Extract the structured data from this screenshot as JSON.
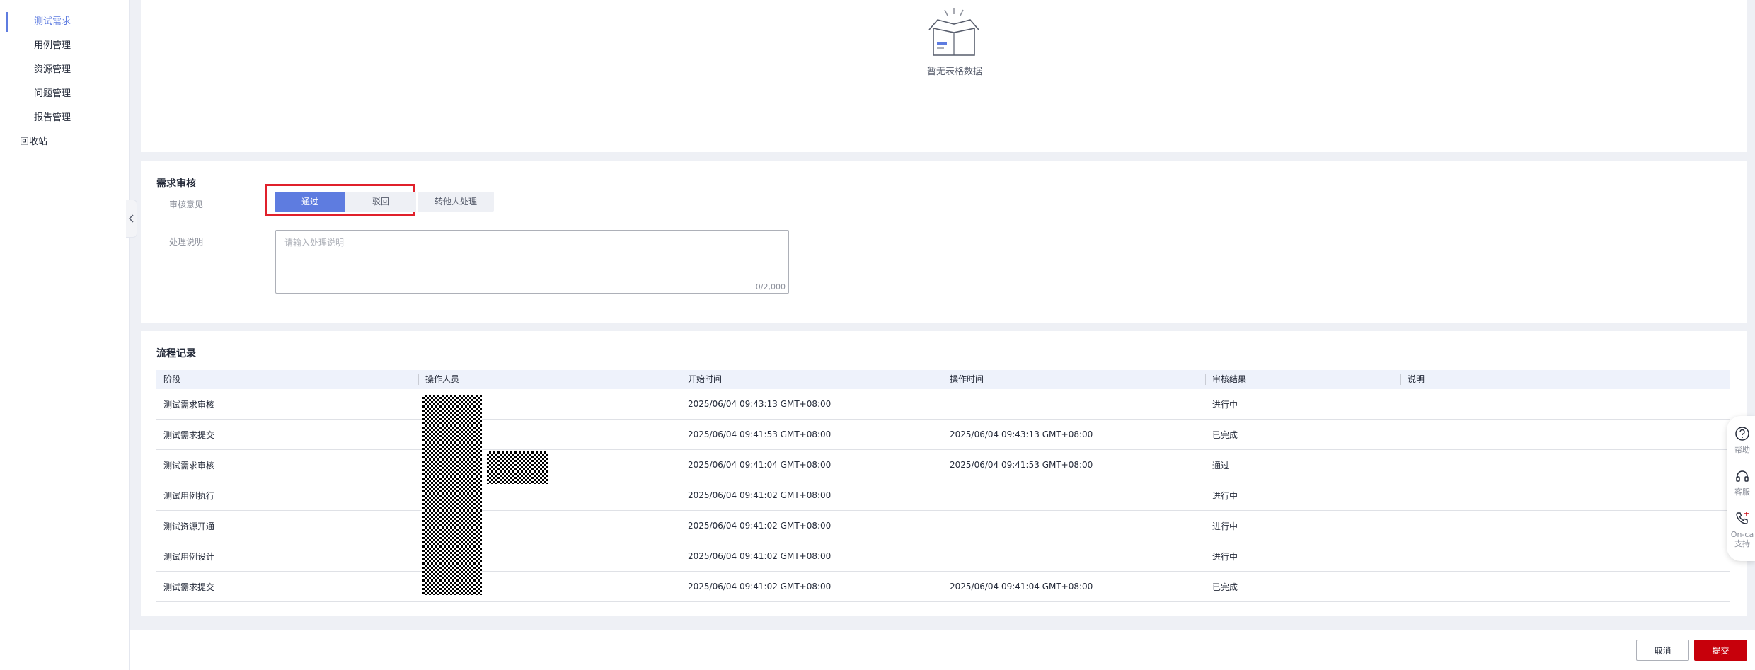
{
  "sidebar": {
    "items": [
      {
        "label": "测试需求",
        "active": true
      },
      {
        "label": "用例管理"
      },
      {
        "label": "资源管理"
      },
      {
        "label": "问题管理"
      },
      {
        "label": "报告管理"
      }
    ],
    "recycle": "回收站"
  },
  "empty_state": {
    "text": "暂无表格数据"
  },
  "review": {
    "title": "需求审核",
    "opinion_label": "审核意见",
    "options": {
      "pass": "通过",
      "reject": "驳回",
      "transfer": "转他人处理"
    },
    "selected": "通过",
    "desc_label": "处理说明",
    "desc_placeholder": "请输入处理说明",
    "char_count": "0/2,000"
  },
  "flow": {
    "title": "流程记录",
    "columns": [
      "阶段",
      "操作人员",
      "开始时间",
      "操作时间",
      "审核结果",
      "说明"
    ],
    "rows": [
      {
        "stage": "测试需求审核",
        "operator": "",
        "start": "2025/06/04 09:43:13 GMT+08:00",
        "op_time": "",
        "result": "进行中",
        "note": ""
      },
      {
        "stage": "测试需求提交",
        "operator": "",
        "start": "2025/06/04 09:41:53 GMT+08:00",
        "op_time": "2025/06/04 09:43:13 GMT+08:00",
        "result": "已完成",
        "note": ""
      },
      {
        "stage": "测试需求审核",
        "operator": "",
        "start": "2025/06/04 09:41:04 GMT+08:00",
        "op_time": "2025/06/04 09:41:53 GMT+08:00",
        "result": "通过",
        "note": ""
      },
      {
        "stage": "测试用例执行",
        "operator": "",
        "start": "2025/06/04 09:41:02 GMT+08:00",
        "op_time": "",
        "result": "进行中",
        "note": ""
      },
      {
        "stage": "测试资源开通",
        "operator": "",
        "start": "2025/06/04 09:41:02 GMT+08:00",
        "op_time": "",
        "result": "进行中",
        "note": ""
      },
      {
        "stage": "测试用例设计",
        "operator": "",
        "start": "2025/06/04 09:41:02 GMT+08:00",
        "op_time": "",
        "result": "进行中",
        "note": ""
      },
      {
        "stage": "测试需求提交",
        "operator": "",
        "start": "2025/06/04 09:41:02 GMT+08:00",
        "op_time": "2025/06/04 09:41:04 GMT+08:00",
        "result": "已完成",
        "note": ""
      }
    ]
  },
  "footer": {
    "cancel": "取消",
    "submit": "提交"
  },
  "float": {
    "help": "帮助",
    "service": "客服",
    "oncall_1": "On-ca",
    "oncall_2": "支持"
  },
  "colors": {
    "primary": "#5e7ce0",
    "danger": "#c7000b",
    "highlight": "#e0202b"
  }
}
